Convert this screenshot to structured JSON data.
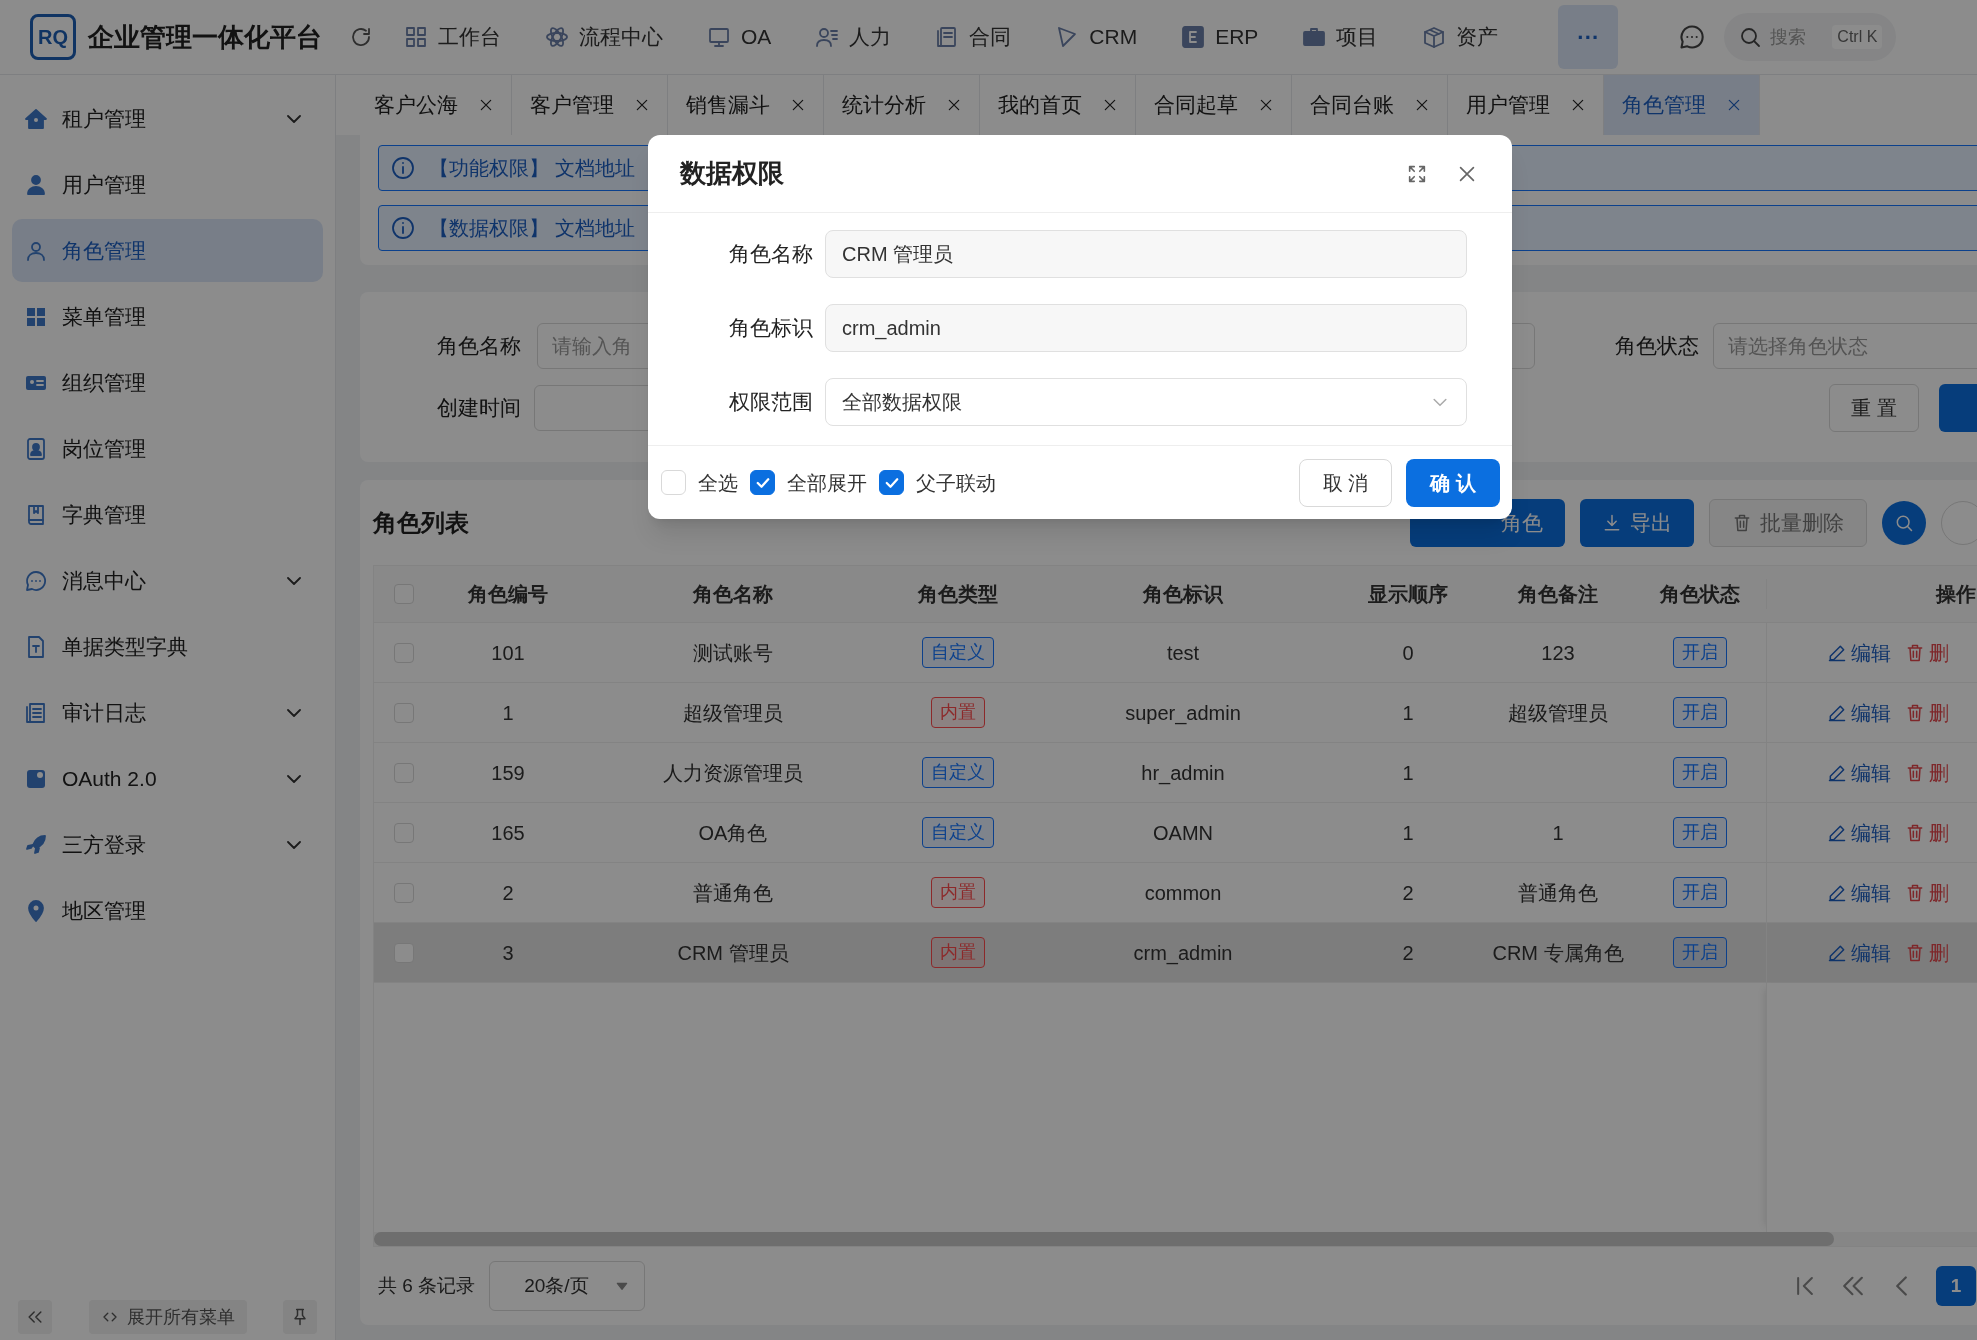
{
  "header": {
    "logo": "RQ",
    "title": "企业管理一体化平台",
    "nav": [
      {
        "label": "工作台"
      },
      {
        "label": "流程中心"
      },
      {
        "label": "OA"
      },
      {
        "label": "人力"
      },
      {
        "label": "合同"
      },
      {
        "label": "CRM"
      },
      {
        "label": "ERP"
      },
      {
        "label": "项目"
      },
      {
        "label": "资产"
      }
    ],
    "more": {
      "label": "···",
      "selected": true
    },
    "search": {
      "placeholder": "搜索",
      "shortcut": "Ctrl K"
    }
  },
  "sidebar": {
    "items": [
      {
        "label": "租户管理",
        "has_children": true,
        "selected": false
      },
      {
        "label": "用户管理",
        "has_children": false,
        "selected": false
      },
      {
        "label": "角色管理",
        "has_children": false,
        "selected": true
      },
      {
        "label": "菜单管理",
        "has_children": false,
        "selected": false
      },
      {
        "label": "组织管理",
        "has_children": false,
        "selected": false
      },
      {
        "label": "岗位管理",
        "has_children": false,
        "selected": false
      },
      {
        "label": "字典管理",
        "has_children": false,
        "selected": false
      },
      {
        "label": "消息中心",
        "has_children": true,
        "selected": false
      },
      {
        "label": "单据类型字典",
        "has_children": false,
        "selected": false
      },
      {
        "label": "审计日志",
        "has_children": true,
        "selected": false
      },
      {
        "label": "OAuth 2.0",
        "has_children": true,
        "selected": false
      },
      {
        "label": "三方登录",
        "has_children": true,
        "selected": false
      },
      {
        "label": "地区管理",
        "has_children": false,
        "selected": false
      }
    ],
    "expand_all": "展开所有菜单"
  },
  "tabs": [
    {
      "label": "客户公海",
      "selected": false
    },
    {
      "label": "客户管理",
      "selected": false
    },
    {
      "label": "销售漏斗",
      "selected": false
    },
    {
      "label": "统计分析",
      "selected": false
    },
    {
      "label": "我的首页",
      "selected": false
    },
    {
      "label": "合同起草",
      "selected": false
    },
    {
      "label": "合同台账",
      "selected": false
    },
    {
      "label": "用户管理",
      "selected": false
    },
    {
      "label": "角色管理",
      "selected": true
    }
  ],
  "alerts": [
    {
      "text": "【功能权限】 文档地址"
    },
    {
      "text": "【数据权限】 文档地址"
    }
  ],
  "search_form": {
    "name": {
      "label": "角色名称",
      "placeholder": "请输入角"
    },
    "status": {
      "label": "角色状态",
      "placeholder": "请选择角色状态"
    },
    "created": {
      "label": "创建时间"
    },
    "reset": "重 置"
  },
  "table": {
    "title": "角色列表",
    "select_all": {
      "checked": false
    },
    "buttons": [
      {
        "label": "角色",
        "kind": "primary",
        "disabled": false
      },
      {
        "label": "导出",
        "kind": "export",
        "disabled": false
      },
      {
        "label": "批量删除",
        "kind": "delete",
        "disabled": true
      }
    ],
    "columns": [
      "角色编号",
      "角色名称",
      "角色类型",
      "角色标识",
      "显示顺序",
      "角色备注",
      "角色状态",
      "操作"
    ],
    "rows": [
      {
        "id": "101",
        "checked": false,
        "name": "测试账号",
        "type": {
          "text": "自定义",
          "kind": "custom"
        },
        "key": "test",
        "order": "0",
        "remark": "123",
        "status": "开启",
        "edit": "编辑",
        "delete": "删",
        "selected": false
      },
      {
        "id": "1",
        "checked": false,
        "name": "超级管理员",
        "type": {
          "text": "内置",
          "kind": "builtin"
        },
        "key": "super_admin",
        "order": "1",
        "remark": "超级管理员",
        "status": "开启",
        "edit": "编辑",
        "delete": "删",
        "selected": false
      },
      {
        "id": "159",
        "checked": false,
        "name": "人力资源管理员",
        "type": {
          "text": "自定义",
          "kind": "custom"
        },
        "key": "hr_admin",
        "order": "1",
        "status": "开启",
        "edit": "编辑",
        "delete": "删",
        "selected": false
      },
      {
        "id": "165",
        "checked": false,
        "name": "OA角色",
        "type": {
          "text": "自定义",
          "kind": "custom"
        },
        "key": "OAMN",
        "order": "1",
        "remark": "1",
        "status": "开启",
        "edit": "编辑",
        "delete": "删",
        "selected": false
      },
      {
        "id": "2",
        "checked": false,
        "name": "普通角色",
        "type": {
          "text": "内置",
          "kind": "builtin"
        },
        "key": "common",
        "order": "2",
        "remark": "普通角色",
        "status": "开启",
        "edit": "编辑",
        "delete": "删",
        "selected": false
      },
      {
        "id": "3",
        "checked": false,
        "name": "CRM 管理员",
        "type": {
          "text": "内置",
          "kind": "builtin"
        },
        "key": "crm_admin",
        "order": "2",
        "remark": "CRM 专属角色",
        "status": "开启",
        "edit": "编辑",
        "delete": "删",
        "selected": true
      }
    ]
  },
  "pagination": {
    "total": "共 6 条记录",
    "page_size": "20条/页",
    "pages": [
      {
        "label": "1",
        "selected": true
      }
    ]
  },
  "dialog": {
    "title": "数据权限",
    "fields": [
      {
        "label": "角色名称",
        "value": "CRM 管理员",
        "kind": "input"
      },
      {
        "label": "角色标识",
        "value": "crm_admin",
        "kind": "input"
      },
      {
        "label": "权限范围",
        "value": "全部数据权限",
        "kind": "select"
      }
    ],
    "options": [
      {
        "label": "全选",
        "checked": false
      },
      {
        "label": "全部展开",
        "checked": true
      },
      {
        "label": "父子联动",
        "checked": true
      }
    ],
    "cancel": "取 消",
    "confirm": "确 认"
  }
}
